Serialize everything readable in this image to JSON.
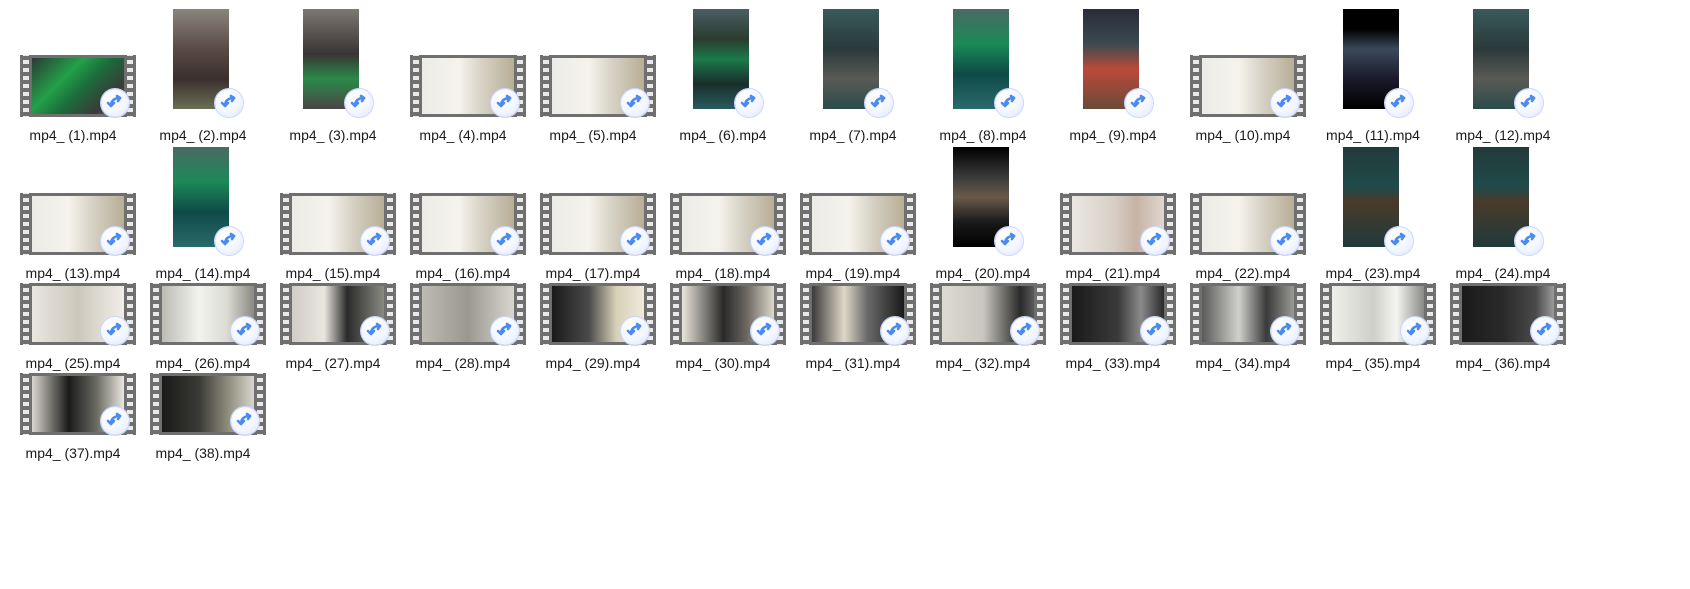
{
  "files": [
    {
      "name": "mp4_ (1).mp4",
      "orientation": "landscape",
      "scene": "c1"
    },
    {
      "name": "mp4_ (2).mp4",
      "orientation": "portrait",
      "scene": "c2"
    },
    {
      "name": "mp4_ (3).mp4",
      "orientation": "portrait",
      "scene": "c3"
    },
    {
      "name": "mp4_ (4).mp4",
      "orientation": "landscape",
      "scene": "c4"
    },
    {
      "name": "mp4_ (5).mp4",
      "orientation": "landscape",
      "scene": "c4"
    },
    {
      "name": "mp4_ (6).mp4",
      "orientation": "portrait",
      "scene": "c5"
    },
    {
      "name": "mp4_ (7).mp4",
      "orientation": "portrait",
      "scene": "c9"
    },
    {
      "name": "mp4_ (8).mp4",
      "orientation": "portrait",
      "scene": "c6"
    },
    {
      "name": "mp4_ (9).mp4",
      "orientation": "portrait",
      "scene": "c7"
    },
    {
      "name": "mp4_ (10).mp4",
      "orientation": "landscape",
      "scene": "c4"
    },
    {
      "name": "mp4_ (11).mp4",
      "orientation": "portrait",
      "scene": "c8"
    },
    {
      "name": "mp4_ (12).mp4",
      "orientation": "portrait",
      "scene": "c9"
    },
    {
      "name": "mp4_ (13).mp4",
      "orientation": "landscape",
      "scene": "c4"
    },
    {
      "name": "mp4_ (14).mp4",
      "orientation": "portrait",
      "scene": "c6"
    },
    {
      "name": "mp4_ (15).mp4",
      "orientation": "landscape",
      "scene": "c4"
    },
    {
      "name": "mp4_ (16).mp4",
      "orientation": "landscape",
      "scene": "c4"
    },
    {
      "name": "mp4_ (17).mp4",
      "orientation": "landscape",
      "scene": "c4"
    },
    {
      "name": "mp4_ (18).mp4",
      "orientation": "landscape",
      "scene": "c4"
    },
    {
      "name": "mp4_ (19).mp4",
      "orientation": "landscape",
      "scene": "c4"
    },
    {
      "name": "mp4_ (20).mp4",
      "orientation": "portrait",
      "scene": "c10"
    },
    {
      "name": "mp4_ (21).mp4",
      "orientation": "landscape",
      "scene": "c11"
    },
    {
      "name": "mp4_ (22).mp4",
      "orientation": "landscape",
      "scene": "c4"
    },
    {
      "name": "mp4_ (23).mp4",
      "orientation": "portrait",
      "scene": "c12"
    },
    {
      "name": "mp4_ (24).mp4",
      "orientation": "portrait",
      "scene": "c12"
    },
    {
      "name": "mp4_ (25).mp4",
      "orientation": "landscape",
      "scene": "c13"
    },
    {
      "name": "mp4_ (26).mp4",
      "orientation": "landscape",
      "scene": "c14"
    },
    {
      "name": "mp4_ (27).mp4",
      "orientation": "landscape",
      "scene": "c15"
    },
    {
      "name": "mp4_ (28).mp4",
      "orientation": "landscape",
      "scene": "c16"
    },
    {
      "name": "mp4_ (29).mp4",
      "orientation": "landscape",
      "scene": "c17"
    },
    {
      "name": "mp4_ (30).mp4",
      "orientation": "landscape",
      "scene": "c18"
    },
    {
      "name": "mp4_ (31).mp4",
      "orientation": "landscape",
      "scene": "c19"
    },
    {
      "name": "mp4_ (32).mp4",
      "orientation": "landscape",
      "scene": "c20"
    },
    {
      "name": "mp4_ (33).mp4",
      "orientation": "landscape",
      "scene": "c21"
    },
    {
      "name": "mp4_ (34).mp4",
      "orientation": "landscape",
      "scene": "c22"
    },
    {
      "name": "mp4_ (35).mp4",
      "orientation": "landscape",
      "scene": "c23"
    },
    {
      "name": "mp4_ (36).mp4",
      "orientation": "landscape",
      "scene": "c24"
    },
    {
      "name": "mp4_ (37).mp4",
      "orientation": "landscape",
      "scene": "c25"
    },
    {
      "name": "mp4_ (38).mp4",
      "orientation": "landscape",
      "scene": "c26"
    }
  ],
  "shortcut_icon": "shortcut-arrow-icon",
  "video_icon": "film-strip-icon",
  "colors": {
    "label_text": "#1a1a1a",
    "background": "#ffffff",
    "shortcut_arrow": "#4a8af4"
  }
}
